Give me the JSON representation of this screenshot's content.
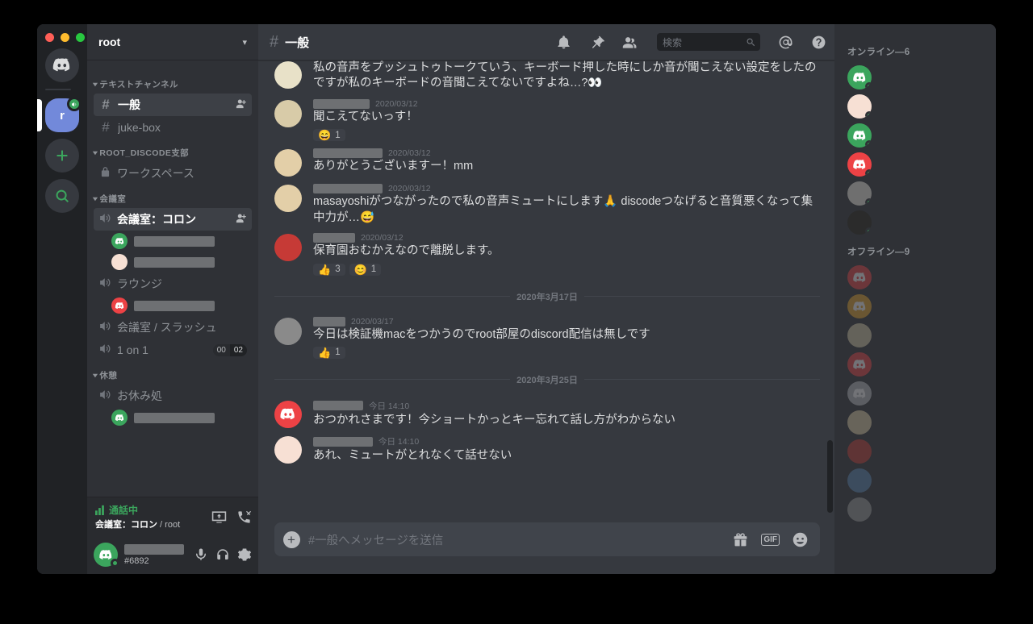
{
  "window": {
    "traffic_lights": [
      "#ff5f57",
      "#febc2e",
      "#28c840"
    ],
    "guild_name": "root",
    "guild_chevron": "▾"
  },
  "rail": {
    "items": [
      {
        "name": "home",
        "icon": "discord-home-icon",
        "label": ""
      },
      {
        "name": "server-root",
        "icon": "server-icon",
        "label": "r",
        "selected": true,
        "voice": true
      },
      {
        "name": "add-server",
        "icon": "plus-icon",
        "label": ""
      },
      {
        "name": "explore-servers",
        "icon": "compass-search-icon",
        "label": ""
      }
    ]
  },
  "sidebar": {
    "categories": [
      {
        "label": "テキストチャンネル",
        "channels": [
          {
            "type": "text",
            "label": "一般",
            "active": true,
            "add_user": true
          },
          {
            "type": "text",
            "label": "juke-box",
            "active": false
          }
        ]
      },
      {
        "label": "ROOT_DISCODE支部",
        "channels": [
          {
            "type": "locked",
            "label": "ワークスペース",
            "active": false
          }
        ]
      },
      {
        "label": "会議室",
        "channels": [
          {
            "type": "voice",
            "label": "会議室：コロン",
            "active": true,
            "add_user": true,
            "members": [
              {
                "avatar": "discord-logo",
                "color": "#3ba55d"
              },
              {
                "avatar": "photo",
                "color": "#f7e0d4"
              }
            ]
          },
          {
            "type": "voice",
            "label": "ラウンジ",
            "active": false,
            "members": [
              {
                "avatar": "discord-logo",
                "color": "#ed4245"
              }
            ]
          },
          {
            "type": "voice",
            "label": "会議室 / スラッシュ",
            "active": false,
            "members": []
          },
          {
            "type": "voice",
            "label": "1 on 1",
            "active": false,
            "members": [],
            "limit_current": "00",
            "limit_max": "02"
          }
        ]
      },
      {
        "label": "休憩",
        "channels": [
          {
            "type": "voice",
            "label": "お休み処",
            "active": false,
            "members": [
              {
                "avatar": "discord-logo",
                "color": "#3ba55d"
              }
            ]
          }
        ]
      }
    ],
    "voice_panel": {
      "status": "通話中",
      "channel": "会議室：コロン",
      "separator": " / ",
      "server": "root",
      "icons": [
        "screen-share-icon",
        "disconnect-call-icon"
      ]
    },
    "user_panel": {
      "tag": "#6892",
      "icons": [
        "microphone-icon",
        "headphones-icon",
        "gear-icon"
      ]
    }
  },
  "chat": {
    "header": {
      "hash": "#",
      "title": "一般",
      "icons": [
        "bell-icon",
        "pin-icon",
        "members-icon",
        "mention-icon",
        "help-icon"
      ]
    },
    "search": {
      "placeholder": "検索",
      "icon": "search-icon"
    },
    "composer": {
      "placeholder": "#一般へメッセージを送信",
      "plus_label": "+",
      "gif_label": "GIF",
      "icons": [
        "gift-icon",
        "gif-icon",
        "emoji-icon"
      ]
    },
    "items": [
      {
        "kind": "message",
        "continued": true,
        "avatar_color": "#e8e1c8",
        "avatar_type": "photo",
        "name_width": 0,
        "time": "",
        "text": "私の音声をプッシュトゥトークていう、キーボード押した時にしか音が聞こえない設定をしたのですが私のキーボードの音聞こえてないですよね…?👀",
        "reactions": []
      },
      {
        "kind": "message",
        "avatar_color": "#d8cba8",
        "avatar_type": "photo",
        "name_width": 70,
        "time": "2020/03/12",
        "text": "聞こえてないっす！",
        "reactions": [
          {
            "emoji": "😄",
            "count": "1"
          }
        ]
      },
      {
        "kind": "message",
        "avatar_color": "#e3cfa8",
        "avatar_type": "photo",
        "name_width": 86,
        "time": "2020/03/12",
        "text": "ありがとうございますー！mm",
        "reactions": []
      },
      {
        "kind": "message",
        "avatar_color": "#e3cfa8",
        "avatar_type": "photo",
        "name_width": 86,
        "time": "2020/03/12",
        "text": "masayoshiがつながったので私の音声ミュートにします🙏 discodeつなげると音質悪くなって集中力が…😅",
        "reactions": []
      },
      {
        "kind": "message",
        "avatar_color": "#c63a36",
        "avatar_type": "photo",
        "name_width": 52,
        "time": "2020/03/12",
        "text": "保育園おむかえなので離脱します。",
        "reactions": [
          {
            "emoji": "👍",
            "count": "3"
          },
          {
            "emoji": "😊",
            "count": "1"
          }
        ]
      },
      {
        "kind": "divider",
        "label": "2020年3月17日"
      },
      {
        "kind": "message",
        "avatar_color": "#8a8a8a",
        "avatar_type": "photo",
        "name_width": 40,
        "time": "2020/03/17",
        "text": "今日は検証機macをつかうのでroot部屋のdiscord配信は無しです",
        "reactions": [
          {
            "emoji": "👍",
            "count": "1"
          }
        ]
      },
      {
        "kind": "divider",
        "label": "2020年3月25日"
      },
      {
        "kind": "message",
        "avatar_color": "#ed4245",
        "avatar_type": "discord-logo",
        "name_width": 62,
        "time": "今日 14:10",
        "text": "おつかれさまです！今ショートかっとキー忘れて話し方がわからない",
        "reactions": []
      },
      {
        "kind": "message",
        "avatar_color": "#f7e0d4",
        "avatar_type": "photo",
        "name_width": 74,
        "time": "今日 14:10",
        "text": "あれ、ミュートがとれなくて話せない",
        "reactions": []
      }
    ]
  },
  "members": {
    "online_label": "オンライン—6",
    "offline_label": "オフライン—9",
    "online": [
      {
        "avatar_type": "discord-logo",
        "color": "#3ba55d"
      },
      {
        "avatar_type": "photo",
        "color": "#f7e0d4"
      },
      {
        "avatar_type": "discord-logo",
        "color": "#3ba55d"
      },
      {
        "avatar_type": "discord-logo",
        "color": "#ed4245"
      },
      {
        "avatar_type": "photo",
        "color": "#6f6f6f"
      },
      {
        "avatar_type": "photo",
        "color": "#2b2b2b"
      }
    ],
    "offline": [
      {
        "avatar_type": "discord-logo",
        "color": "#ed4245"
      },
      {
        "avatar_type": "discord-logo",
        "color": "#e5a62a"
      },
      {
        "avatar_type": "photo",
        "color": "#d8cba8"
      },
      {
        "avatar_type": "discord-logo",
        "color": "#ed4245"
      },
      {
        "avatar_type": "discord-logo",
        "color": "#b9bbbe"
      },
      {
        "avatar_type": "photo",
        "color": "#e3cfa8"
      },
      {
        "avatar_type": "photo",
        "color": "#c63a36"
      },
      {
        "avatar_type": "photo",
        "color": "#5a86b5"
      },
      {
        "avatar_type": "photo",
        "color": "#9a9a9a"
      }
    ]
  }
}
